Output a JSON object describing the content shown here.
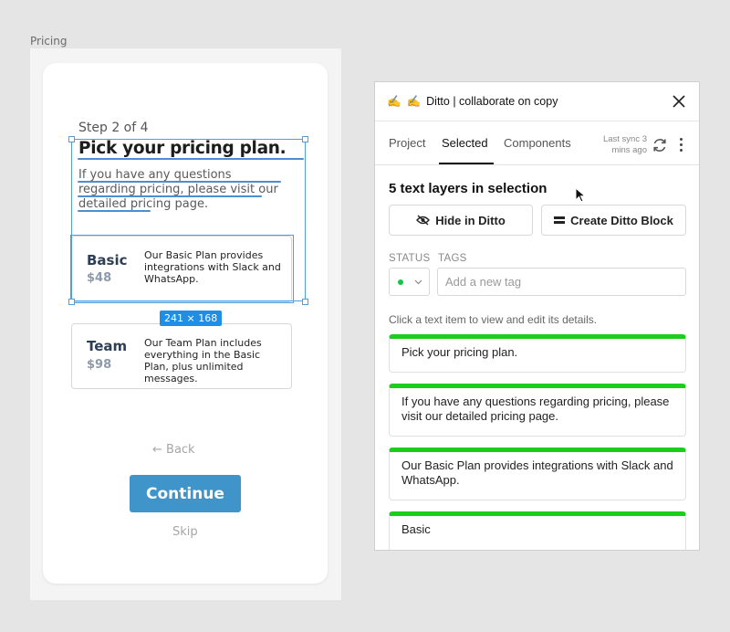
{
  "canvas": {
    "frame_label": "Pricing"
  },
  "mock": {
    "step": "Step 2 of 4",
    "headline": "Pick your pricing plan.",
    "description": "If you have any questions regarding pricing, please visit our detailed pricing page.",
    "plans": [
      {
        "name": "Basic",
        "price": "$48",
        "desc": "Our Basic Plan provides integrations with Slack and WhatsApp."
      },
      {
        "name": "Team",
        "price": "$98",
        "desc": "Our Team Plan includes everything in the Basic Plan, plus unlimited messages."
      }
    ],
    "selection_dimensions": "241 × 168",
    "back": "← Back",
    "continue": "Continue",
    "skip": "Skip"
  },
  "panel": {
    "title": "Ditto | collaborate on copy",
    "title_emoji": "✍️",
    "tabs": [
      "Project",
      "Selected",
      "Components"
    ],
    "active_tab": "Selected",
    "last_sync": "Last sync 3 mins ago",
    "selection_title": "5 text layers in selection",
    "hide_button": "Hide in Ditto",
    "create_button": "Create Ditto Block",
    "status_label": "STATUS",
    "tags_label": "TAGS",
    "tag_placeholder": "Add a new tag",
    "hint": "Click a text item to view and edit its details.",
    "status_color": "#18c24a",
    "accent": "#19cf19",
    "text_items": [
      "Pick your pricing plan.",
      "If you have any questions regarding pricing, please visit our detailed pricing page.",
      "Our Basic Plan provides integrations with Slack and WhatsApp.",
      "Basic"
    ]
  }
}
